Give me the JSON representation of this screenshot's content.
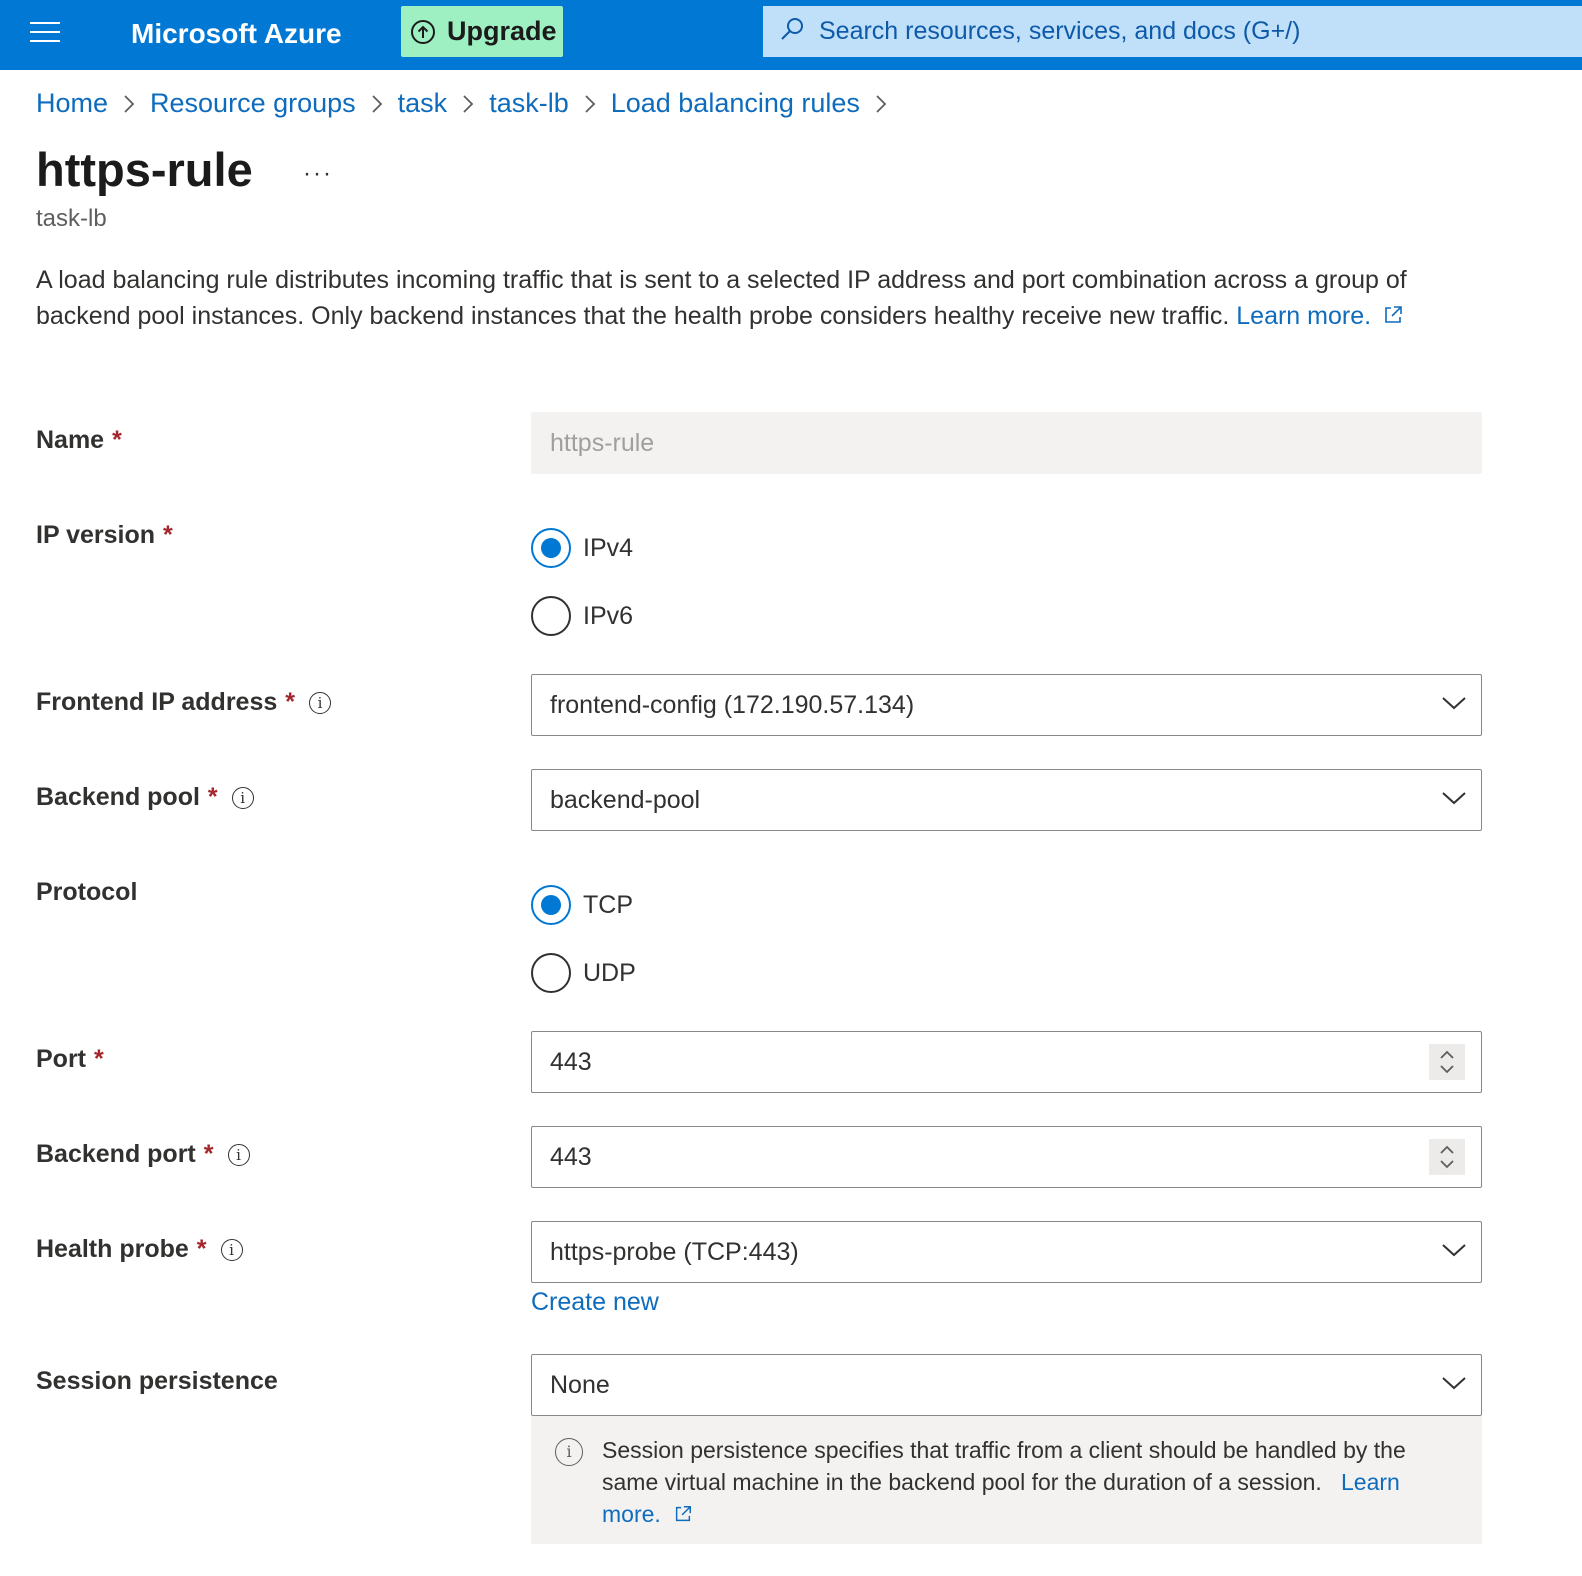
{
  "topbar": {
    "menu_icon": "hamburger-icon",
    "brand": "Microsoft Azure",
    "upgrade_label": "Upgrade",
    "upgrade_icon": "arrow-up-circle-icon",
    "search_placeholder": "Search resources, services, and docs (G+/)",
    "search_icon": "search-icon",
    "colors": {
      "bar": "#0078d4",
      "upgrade_bg": "#9ef0c3",
      "search_bg": "#bfe0f8"
    }
  },
  "breadcrumb": [
    "Home",
    "Resource groups",
    "task",
    "task-lb",
    "Load balancing rules"
  ],
  "page": {
    "title": "https-rule",
    "more": "···",
    "subtitle": "task-lb",
    "description": "A load balancing rule distributes incoming traffic that is sent to a selected IP address and port combination across a group of backend pool instances. Only backend instances that the health probe considers healthy receive new traffic.",
    "learn_more": "Learn more."
  },
  "form": {
    "required_mark": "*",
    "info_glyph": "i",
    "name": {
      "label": "Name",
      "value": "https-rule"
    },
    "ip_version": {
      "label": "IP version",
      "options": [
        "IPv4",
        "IPv6"
      ],
      "selected": "IPv4"
    },
    "frontend_ip": {
      "label": "Frontend IP address",
      "value": "frontend-config (172.190.57.134)"
    },
    "backend_pool": {
      "label": "Backend pool",
      "value": "backend-pool"
    },
    "protocol": {
      "label": "Protocol",
      "options": [
        "TCP",
        "UDP"
      ],
      "selected": "TCP"
    },
    "port": {
      "label": "Port",
      "value": "443"
    },
    "backend_port": {
      "label": "Backend port",
      "value": "443"
    },
    "health_probe": {
      "label": "Health probe",
      "value": "https-probe (TCP:443)",
      "create_new": "Create new"
    },
    "session_persistence": {
      "label": "Session persistence",
      "value": "None",
      "info_text": "Session persistence specifies that traffic from a client should be handled by the same virtual machine in the backend pool for the duration of a session.",
      "learn_more": "Learn more."
    }
  },
  "accent_color": "#0078d4",
  "link_color": "#0f6cbd",
  "required_color": "#a4262c"
}
